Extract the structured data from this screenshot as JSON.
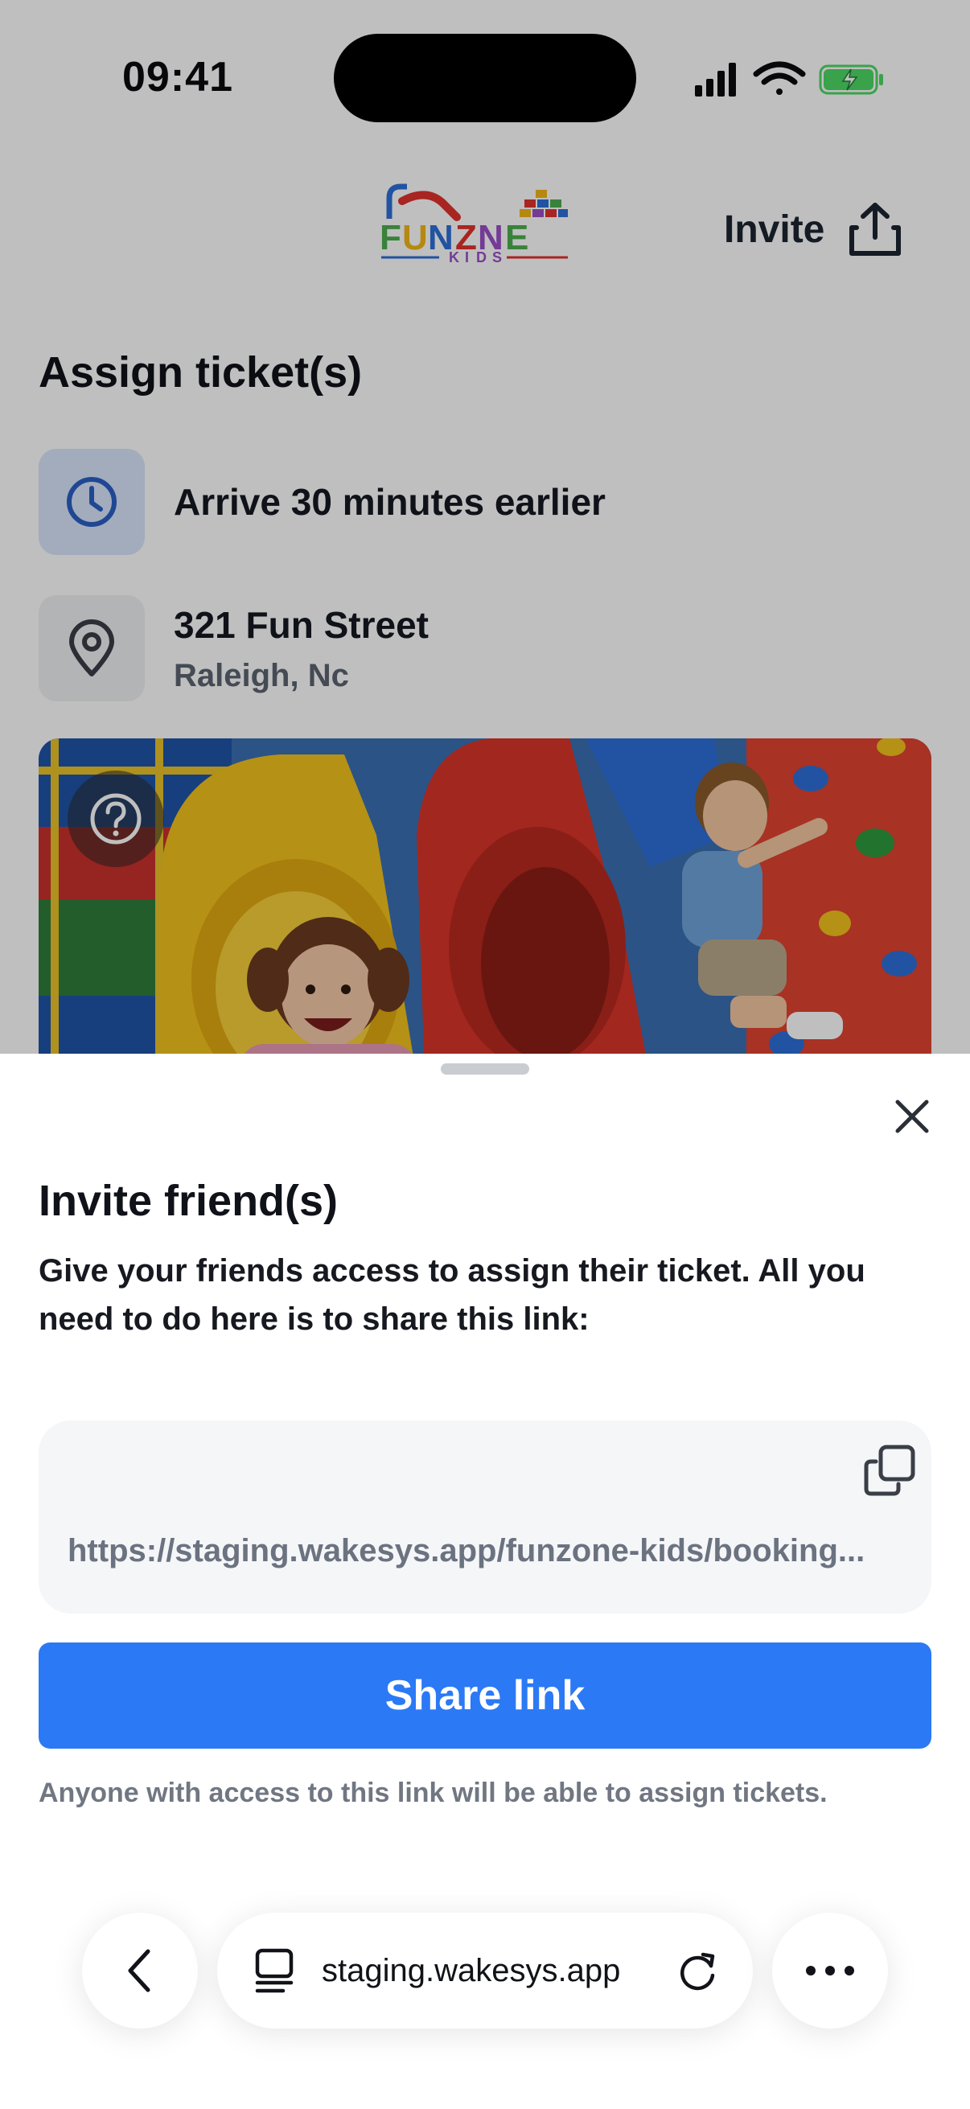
{
  "status_bar": {
    "time": "09:41"
  },
  "header": {
    "logo_text": "FUNZONE KIDS",
    "invite_label": "Invite"
  },
  "page": {
    "title": "Assign ticket(s)",
    "arrive_text": "Arrive 30 minutes earlier",
    "address_line1": "321 Fun Street",
    "address_line2": "Raleigh, Nc"
  },
  "sheet": {
    "title": "Invite friend(s)",
    "description": "Give your friends access to assign their ticket. All you need to do here is to share this link:",
    "link": "https://staging.wakesys.app/funzone-kids/booking...",
    "share_label": "Share link",
    "note": "Anyone with access to this link will be able to assign tickets."
  },
  "browser": {
    "url": "staging.wakesys.app"
  },
  "colors": {
    "accent": "#2b79f5",
    "clock_icon": "#2a5fc4",
    "dim_overlay": "rgba(0,0,0,0.25)"
  }
}
